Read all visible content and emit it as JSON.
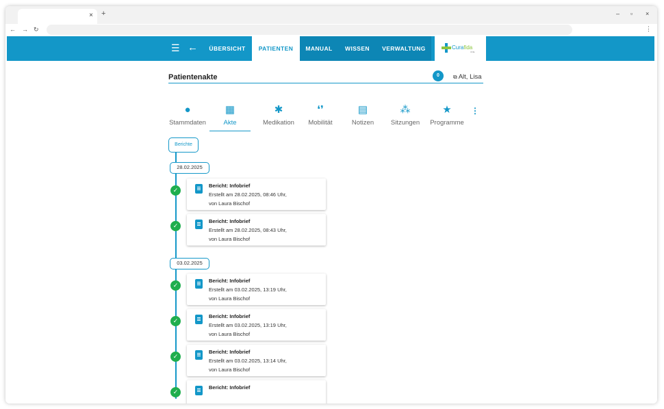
{
  "browser": {
    "tab_close": "×",
    "new_tab": "+",
    "minimize": "–",
    "restore": "▫",
    "close": "×",
    "back": "←",
    "forward": "→",
    "reload": "↻",
    "menu": "⋮"
  },
  "header": {
    "nav": [
      {
        "label": "ÜBERSICHT"
      },
      {
        "label": "PATIENTEN"
      },
      {
        "label": "MANUAL"
      },
      {
        "label": "WISSEN"
      },
      {
        "label": "VERWALTUNG"
      }
    ],
    "logo_text_a": "Cura",
    "logo_text_b": "fida",
    "logo_sub": "ONE",
    "colors": {
      "primary": "#1397c8",
      "primary_dark": "#0d86b5",
      "accent": "#8cc63f"
    }
  },
  "page": {
    "title": "Patientenakte",
    "badge_count": "0",
    "patient_name": "Alt, Lisa"
  },
  "subtabs": [
    {
      "label": "Stammdaten",
      "icon": "person-icon"
    },
    {
      "label": "Akte",
      "icon": "calendar-icon"
    },
    {
      "label": "Medikation",
      "icon": "asterisk-icon"
    },
    {
      "label": "Mobilität",
      "icon": "footprints-icon"
    },
    {
      "label": "Notizen",
      "icon": "note-icon"
    },
    {
      "label": "Sitzungen",
      "icon": "group-icon"
    },
    {
      "label": "Programme",
      "icon": "star-icon"
    }
  ],
  "filter": {
    "label": "Berichte"
  },
  "timeline": {
    "groups": [
      {
        "date": "28.02.2025",
        "entries": [
          {
            "title": "Bericht: Infobrief",
            "created": "Erstellt am 28.02.2025, 08:46 Uhr,",
            "author": "von Laura Bischof"
          },
          {
            "title": "Bericht: Infobrief",
            "created": "Erstellt am 28.02.2025, 08:43 Uhr,",
            "author": "von Laura Bischof"
          }
        ]
      },
      {
        "date": "03.02.2025",
        "entries": [
          {
            "title": "Bericht: Infobrief",
            "created": "Erstellt am 03.02.2025, 13:19 Uhr,",
            "author": "von Laura Bischof"
          },
          {
            "title": "Bericht: Infobrief",
            "created": "Erstellt am 03.02.2025, 13:19 Uhr,",
            "author": "von Laura Bischof"
          },
          {
            "title": "Bericht: Infobrief",
            "created": "Erstellt am 03.02.2025, 13:14 Uhr,",
            "author": "von Laura Bischof"
          },
          {
            "title": "Bericht: Infobrief",
            "created": "",
            "author": ""
          }
        ]
      }
    ]
  }
}
